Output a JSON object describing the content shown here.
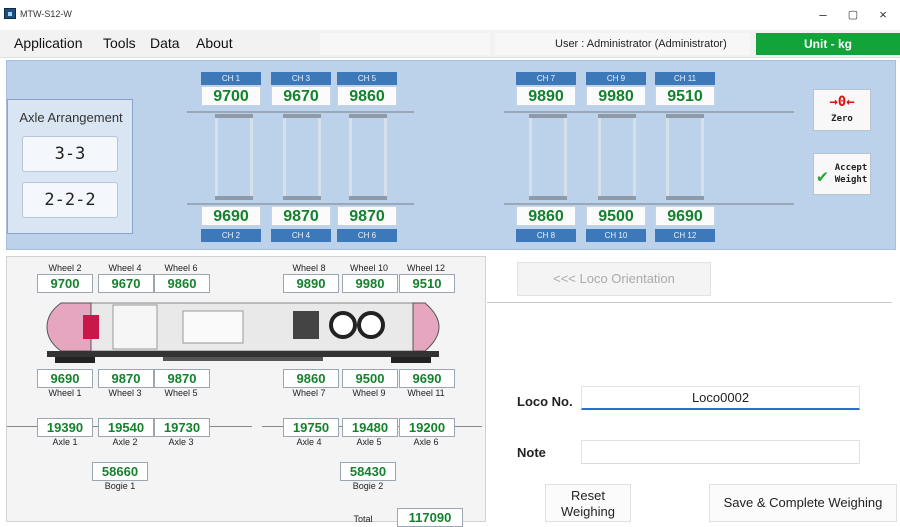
{
  "window": {
    "title": "MTW-S12-W",
    "minimize": "–",
    "maximize": "▢",
    "close": "×"
  },
  "menu": {
    "items": [
      "Application",
      "Tools",
      "Data",
      "About"
    ]
  },
  "status": {
    "user": "User : Administrator (Administrator)",
    "unit": "Unit - kg",
    "unit_color": "#12a33a"
  },
  "axle_arrangement": {
    "title": "Axle Arrangement",
    "options": [
      "3-3",
      "2-2-2"
    ]
  },
  "channels": {
    "top": [
      {
        "label": "CH 1",
        "value": "9700"
      },
      {
        "label": "CH 3",
        "value": "9670"
      },
      {
        "label": "CH 5",
        "value": "9860"
      },
      {
        "label": "CH 7",
        "value": "9890"
      },
      {
        "label": "CH 9",
        "value": "9980"
      },
      {
        "label": "CH 11",
        "value": "9510"
      }
    ],
    "bottom": [
      {
        "label": "CH 2",
        "value": "9690"
      },
      {
        "label": "CH 4",
        "value": "9870"
      },
      {
        "label": "CH 6",
        "value": "9870"
      },
      {
        "label": "CH 8",
        "value": "9860"
      },
      {
        "label": "CH 10",
        "value": "9500"
      },
      {
        "label": "CH 12",
        "value": "9690"
      }
    ]
  },
  "buttons": {
    "zero": {
      "symbol": "→0←",
      "label": "Zero"
    },
    "accept": {
      "label_line1": "Accept",
      "label_line2": "Weight",
      "icon": "check-icon"
    }
  },
  "diagram": {
    "wheels_top": [
      {
        "label": "Wheel 2",
        "value": "9700"
      },
      {
        "label": "Wheel 4",
        "value": "9670"
      },
      {
        "label": "Wheel 6",
        "value": "9860"
      },
      {
        "label": "Wheel 8",
        "value": "9890"
      },
      {
        "label": "Wheel 10",
        "value": "9980"
      },
      {
        "label": "Wheel 12",
        "value": "9510"
      }
    ],
    "wheels_bottom": [
      {
        "label": "Wheel 1",
        "value": "9690"
      },
      {
        "label": "Wheel 3",
        "value": "9870"
      },
      {
        "label": "Wheel 5",
        "value": "9870"
      },
      {
        "label": "Wheel 7",
        "value": "9860"
      },
      {
        "label": "Wheel 9",
        "value": "9500"
      },
      {
        "label": "Wheel 11",
        "value": "9690"
      }
    ],
    "axles": [
      {
        "label": "Axle 1",
        "value": "19390"
      },
      {
        "label": "Axle 2",
        "value": "19540"
      },
      {
        "label": "Axle 3",
        "value": "19730"
      },
      {
        "label": "Axle 4",
        "value": "19750"
      },
      {
        "label": "Axle 5",
        "value": "19480"
      },
      {
        "label": "Axle 6",
        "value": "19200"
      }
    ],
    "bogies": [
      {
        "label": "Bogie 1",
        "value": "58660"
      },
      {
        "label": "Bogie 2",
        "value": "58430"
      }
    ],
    "total": {
      "label": "Total",
      "value": "117090"
    }
  },
  "right_panel": {
    "orientation_button": "<<< Loco Orientation",
    "loco_no_label": "Loco No.",
    "loco_no_value": "Loco0002",
    "note_label": "Note",
    "note_value": "",
    "reset_line1": "Reset",
    "reset_line2": "Weighing",
    "save_button": "Save & Complete Weighing"
  }
}
